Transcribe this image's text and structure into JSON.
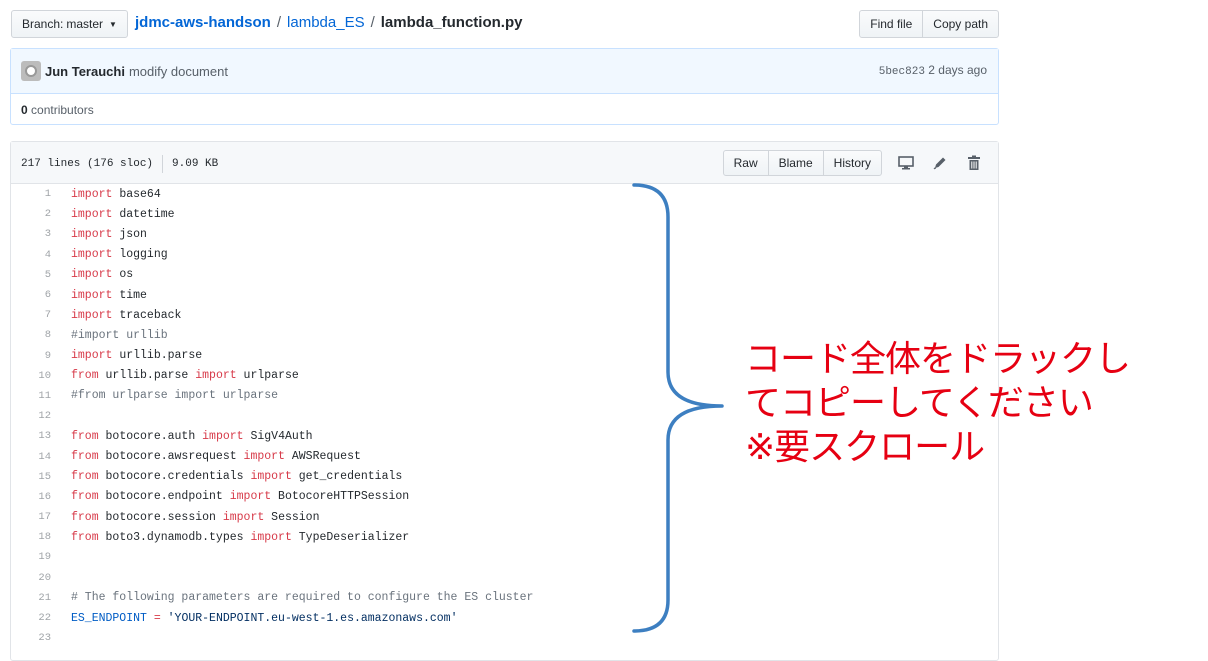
{
  "branch": {
    "label": "Branch:",
    "name": "master"
  },
  "breadcrumb": {
    "repo": "jdmc-aws-handson",
    "sep": "/",
    "dir": "lambda_ES",
    "file": "lambda_function.py"
  },
  "topbar": {
    "find_file": "Find file",
    "copy_path": "Copy path"
  },
  "commit": {
    "author": "Jun Terauchi",
    "message": "modify document",
    "sha": "5bec823",
    "time": "2 days ago"
  },
  "contributors": {
    "count": "0",
    "label": "contributors"
  },
  "file": {
    "lines": "217 lines (176 sloc)",
    "size": "9.09 KB",
    "raw": "Raw",
    "blame": "Blame",
    "history": "History"
  },
  "code": [
    {
      "n": "1",
      "parts": [
        {
          "t": "import",
          "c": "kw"
        },
        {
          "t": " base64",
          "c": ""
        }
      ]
    },
    {
      "n": "2",
      "parts": [
        {
          "t": "import",
          "c": "kw"
        },
        {
          "t": " datetime",
          "c": ""
        }
      ]
    },
    {
      "n": "3",
      "parts": [
        {
          "t": "import",
          "c": "kw"
        },
        {
          "t": " json",
          "c": ""
        }
      ]
    },
    {
      "n": "4",
      "parts": [
        {
          "t": "import",
          "c": "kw"
        },
        {
          "t": " logging",
          "c": ""
        }
      ]
    },
    {
      "n": "5",
      "parts": [
        {
          "t": "import",
          "c": "kw"
        },
        {
          "t": " os",
          "c": ""
        }
      ]
    },
    {
      "n": "6",
      "parts": [
        {
          "t": "import",
          "c": "kw"
        },
        {
          "t": " time",
          "c": ""
        }
      ]
    },
    {
      "n": "7",
      "parts": [
        {
          "t": "import",
          "c": "kw"
        },
        {
          "t": " traceback",
          "c": ""
        }
      ]
    },
    {
      "n": "8",
      "parts": [
        {
          "t": "#import urllib",
          "c": "cm"
        }
      ]
    },
    {
      "n": "9",
      "parts": [
        {
          "t": "import",
          "c": "kw"
        },
        {
          "t": " urllib.parse",
          "c": ""
        }
      ]
    },
    {
      "n": "10",
      "parts": [
        {
          "t": "from",
          "c": "kw"
        },
        {
          "t": " urllib.parse ",
          "c": ""
        },
        {
          "t": "import",
          "c": "kw"
        },
        {
          "t": " urlparse",
          "c": ""
        }
      ]
    },
    {
      "n": "11",
      "parts": [
        {
          "t": "#from urlparse import urlparse",
          "c": "cm"
        }
      ]
    },
    {
      "n": "12",
      "parts": []
    },
    {
      "n": "13",
      "parts": [
        {
          "t": "from",
          "c": "kw"
        },
        {
          "t": " botocore.auth ",
          "c": ""
        },
        {
          "t": "import",
          "c": "kw"
        },
        {
          "t": " SigV4Auth",
          "c": ""
        }
      ]
    },
    {
      "n": "14",
      "parts": [
        {
          "t": "from",
          "c": "kw"
        },
        {
          "t": " botocore.awsrequest ",
          "c": ""
        },
        {
          "t": "import",
          "c": "kw"
        },
        {
          "t": " AWSRequest",
          "c": ""
        }
      ]
    },
    {
      "n": "15",
      "parts": [
        {
          "t": "from",
          "c": "kw"
        },
        {
          "t": " botocore.credentials ",
          "c": ""
        },
        {
          "t": "import",
          "c": "kw"
        },
        {
          "t": " get_credentials",
          "c": ""
        }
      ]
    },
    {
      "n": "16",
      "parts": [
        {
          "t": "from",
          "c": "kw"
        },
        {
          "t": " botocore.endpoint ",
          "c": ""
        },
        {
          "t": "import",
          "c": "kw"
        },
        {
          "t": " BotocoreHTTPSession",
          "c": ""
        }
      ]
    },
    {
      "n": "17",
      "parts": [
        {
          "t": "from",
          "c": "kw"
        },
        {
          "t": " botocore.session ",
          "c": ""
        },
        {
          "t": "import",
          "c": "kw"
        },
        {
          "t": " Session",
          "c": ""
        }
      ]
    },
    {
      "n": "18",
      "parts": [
        {
          "t": "from",
          "c": "kw"
        },
        {
          "t": " boto3.dynamodb.types ",
          "c": ""
        },
        {
          "t": "import",
          "c": "kw"
        },
        {
          "t": " TypeDeserializer",
          "c": ""
        }
      ]
    },
    {
      "n": "19",
      "parts": []
    },
    {
      "n": "20",
      "parts": []
    },
    {
      "n": "21",
      "parts": [
        {
          "t": "# The following parameters are required to configure the ES cluster",
          "c": "cm"
        }
      ]
    },
    {
      "n": "22",
      "parts": [
        {
          "t": "ES_ENDPOINT",
          "c": "cn"
        },
        {
          "t": " ",
          "c": ""
        },
        {
          "t": "=",
          "c": "kw"
        },
        {
          "t": " ",
          "c": ""
        },
        {
          "t": "'YOUR-ENDPOINT.eu-west-1.es.amazonaws.com'",
          "c": "st"
        }
      ]
    },
    {
      "n": "23",
      "parts": []
    }
  ],
  "annotation": {
    "line1": "コード全体をドラックし",
    "line2": "てコピーしてください",
    "line3": "※要スクロール",
    "color": "#e60012"
  },
  "colors": {
    "link": "#0366d6",
    "keyword": "#d73a49",
    "brace": "#3d7fc1"
  },
  "icons": [
    "desktop-icon",
    "pencil-icon",
    "trash-icon"
  ]
}
